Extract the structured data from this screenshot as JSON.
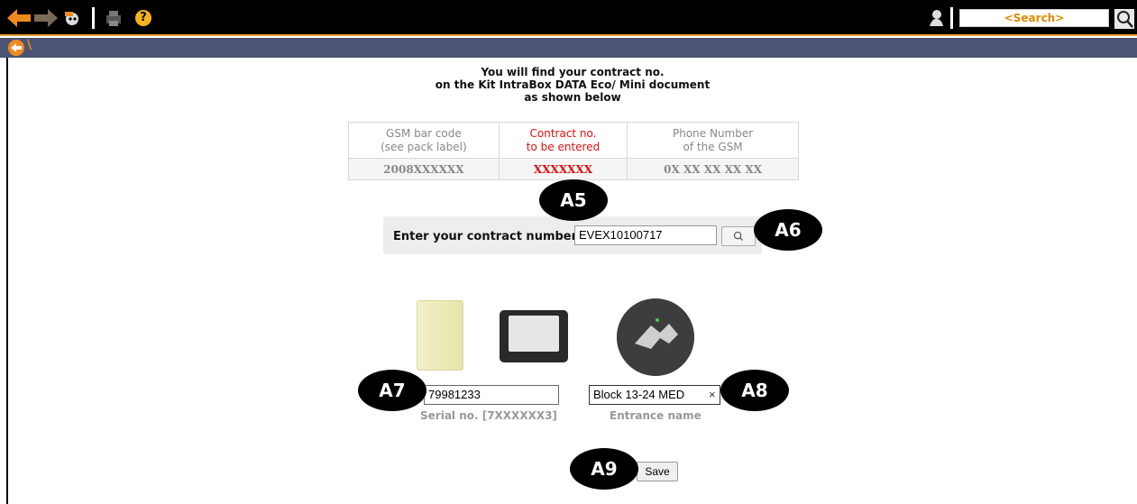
{
  "toolbar": {
    "search_placeholder": "<Search>",
    "help_glyph": "?",
    "icons": [
      "back-arrow-icon",
      "forward-arrow-icon",
      "robot-icon",
      "printer-icon",
      "help-icon",
      "user-icon",
      "magnifier-icon"
    ],
    "accent_color": "#f08a1c"
  },
  "intro": {
    "line1": "You will find your contract no.",
    "line2": "on the Kit IntraBox DATA Eco/ Mini document",
    "line3": "as shown below"
  },
  "reference_table": {
    "headers": [
      {
        "line1": "GSM bar code",
        "line2": "(see pack label)"
      },
      {
        "line1": "Contract no.",
        "line2": "to be entered"
      },
      {
        "line1": "Phone Number",
        "line2": "of the GSM"
      }
    ],
    "values": [
      "2008XXXXXX",
      "XXXXXXX",
      "0X XX XX XX XX"
    ]
  },
  "contract": {
    "label": "Enter your contract number",
    "value": "EVEX10100717"
  },
  "device": {
    "serial_value": "79981233",
    "serial_caption": "Serial no. [7XXXXXX3]",
    "entrance_value": "Block 13-24 MED",
    "entrance_caption": "Entrance name",
    "clear_glyph": "×"
  },
  "save_label": "Save",
  "badges": [
    "A5",
    "A6",
    "A7",
    "A8",
    "A9"
  ]
}
